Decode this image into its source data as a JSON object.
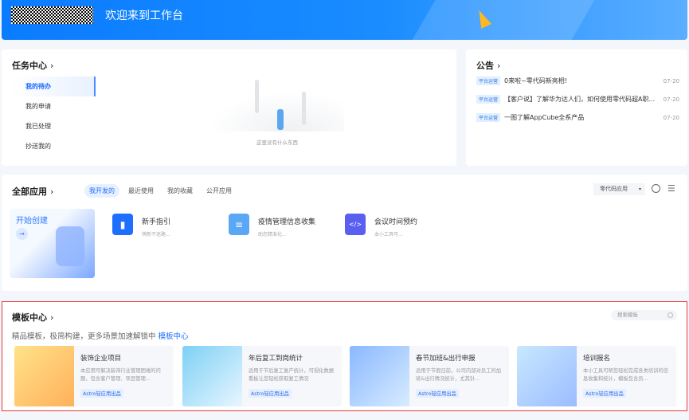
{
  "header": {
    "title": "欢迎来到工作台"
  },
  "tasks": {
    "title": "任务中心",
    "items": [
      "我的待办",
      "我的申请",
      "我已处理",
      "抄送我的"
    ],
    "empty_text": "这里没有什么东西"
  },
  "announcements": {
    "title": "公告",
    "items": [
      {
        "tag": "平台运营",
        "text": "0来啦~零代码新亮相!",
        "date": "07-20"
      },
      {
        "tag": "平台运营",
        "text": "【客户说】了解华为达人们，如何使用零代码超A职...",
        "date": "07-20"
      },
      {
        "tag": "平台运营",
        "text": "一图了解AppCube全系产品",
        "date": "07-20"
      }
    ]
  },
  "apps": {
    "title": "全部应用",
    "tabs": [
      "我开发的",
      "最近使用",
      "我的收藏",
      "公开应用"
    ],
    "filter": "零代码应用",
    "create_label": "开始创建",
    "items": [
      {
        "name": "新手指引",
        "desc": "萌新不迷路..."
      },
      {
        "name": "疫情管理信息收集",
        "desc": "助您精准化..."
      },
      {
        "name": "会议时间预约",
        "desc": "本小工具可..."
      }
    ]
  },
  "templates": {
    "title": "模板中心",
    "search_placeholder": "搜索模板",
    "subtitle": "精品模板，极简构建，更多场景加速解锁中",
    "link": "模板中心",
    "items": [
      {
        "name": "装饰企业项目",
        "desc": "本应用可解决装饰行业管理困难的问题，包含客户管理、项目管理...",
        "badge": "Astro轻应用出品"
      },
      {
        "name": "年后复工到岗统计",
        "desc": "适用于节后复工复产统计，可视化数据看板让您轻松获取复工情况",
        "badge": "Astro轻应用出品"
      },
      {
        "name": "春节加班&出行申报",
        "desc": "适用于节假日前，公司内部对员工的加班&出行情况统计，尤其针...",
        "badge": "Astro轻应用出品"
      },
      {
        "name": "培训报名",
        "desc": "本小工具可帮您轻松完成各类培训的信息收集和统计，模板包含员...",
        "badge": "Astro轻应用出品"
      }
    ]
  },
  "colors": {
    "accent": "#1a6cff",
    "highlight_border": "#e53935"
  }
}
